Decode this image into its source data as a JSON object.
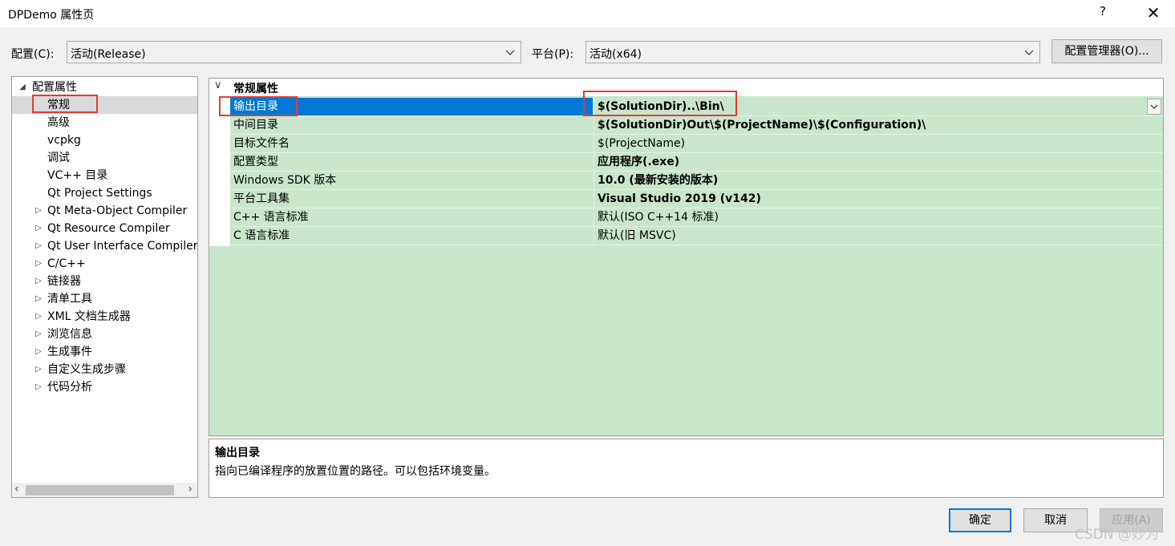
{
  "window": {
    "title": "DPDemo 属性页",
    "help": "?",
    "close": "✕"
  },
  "config": {
    "label": "配置(C):",
    "value": "活动(Release)"
  },
  "platform": {
    "label": "平台(P):",
    "value": "活动(x64)"
  },
  "config_manager_label": "配置管理器(O)...",
  "tree": {
    "root": "配置属性",
    "items": [
      {
        "label": "常规",
        "selected": true
      },
      {
        "label": "高级"
      },
      {
        "label": "vcpkg"
      },
      {
        "label": "调试"
      },
      {
        "label": "VC++ 目录"
      },
      {
        "label": "Qt Project Settings"
      },
      {
        "label": "Qt Meta-Object Compiler",
        "expandable": true
      },
      {
        "label": "Qt Resource Compiler",
        "expandable": true
      },
      {
        "label": "Qt User Interface Compiler",
        "expandable": true
      },
      {
        "label": "C/C++",
        "expandable": true
      },
      {
        "label": "链接器",
        "expandable": true
      },
      {
        "label": "清单工具",
        "expandable": true
      },
      {
        "label": "XML 文档生成器",
        "expandable": true
      },
      {
        "label": "浏览信息",
        "expandable": true
      },
      {
        "label": "生成事件",
        "expandable": true
      },
      {
        "label": "自定义生成步骤",
        "expandable": true
      },
      {
        "label": "代码分析",
        "expandable": true
      }
    ]
  },
  "grid": {
    "section": "常规属性",
    "rows": [
      {
        "name": "输出目录",
        "value": "$(SolutionDir)..\\Bin\\",
        "bold": true,
        "selected": true
      },
      {
        "name": "中间目录",
        "value": "$(SolutionDir)Out\\$(ProjectName)\\$(Configuration)\\",
        "bold": true
      },
      {
        "name": "目标文件名",
        "value": "$(ProjectName)",
        "bold": false
      },
      {
        "name": "配置类型",
        "value": "应用程序(.exe)",
        "bold": true
      },
      {
        "name": "Windows SDK 版本",
        "value": "10.0 (最新安装的版本)",
        "bold": true
      },
      {
        "name": "平台工具集",
        "value": "Visual Studio 2019 (v142)",
        "bold": true
      },
      {
        "name": "C++ 语言标准",
        "value": "默认(ISO C++14 标准)",
        "bold": false
      },
      {
        "name": "C 语言标准",
        "value": "默认(旧 MSVC)",
        "bold": false
      }
    ]
  },
  "description": {
    "title": "输出目录",
    "text": "指向已编译程序的放置位置的路径。可以包括环境变量。"
  },
  "buttons": {
    "ok": "确定",
    "cancel": "取消",
    "apply": "应用(A)"
  },
  "watermark": "CSDN @妙为",
  "colors": {
    "grid_bg": "#c8e6cc",
    "selection": "#0078d7",
    "highlight_box": "#e53935"
  }
}
